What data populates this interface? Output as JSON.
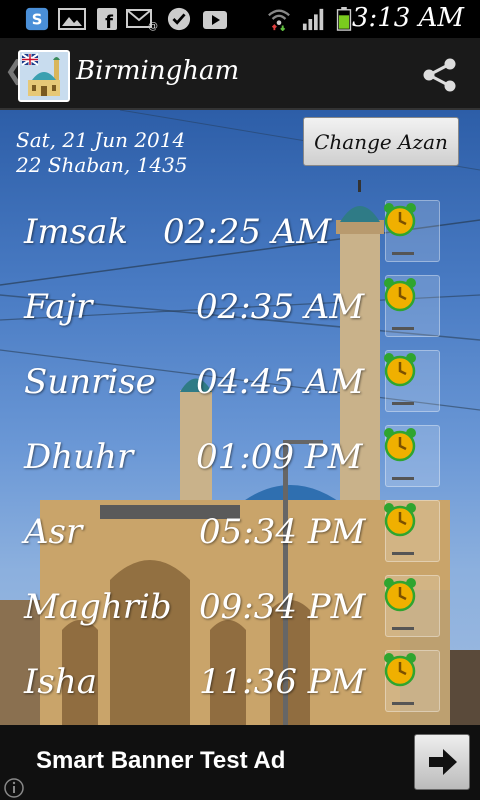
{
  "status_bar": {
    "time": "3:13 AM",
    "icons": [
      "skype-icon",
      "gallery-icon",
      "facebook-icon",
      "email-icon",
      "check-icon",
      "youtube-icon",
      "wifi-icon",
      "signal-icon",
      "battery-icon"
    ]
  },
  "action_bar": {
    "title": "Birmingham",
    "back_icon": "chevron-left-icon",
    "logo_icon": "mosque-flag-icon",
    "share_icon": "share-icon"
  },
  "main": {
    "date_gregorian": "Sat, 21 Jun 2014",
    "date_hijri": "22 Shaban, 1435",
    "change_azan_label": "Change Azan",
    "prayers": [
      {
        "name": "Imsak",
        "time": "02:25 AM"
      },
      {
        "name": "Fajr",
        "time": "02:35 AM"
      },
      {
        "name": "Sunrise",
        "time": "04:45 AM"
      },
      {
        "name": "Dhuhr",
        "time": "01:09 PM"
      },
      {
        "name": "Asr",
        "time": "05:34 PM"
      },
      {
        "name": "Maghrib",
        "time": "09:34 PM"
      },
      {
        "name": "Isha",
        "time": "11:36 PM"
      }
    ]
  },
  "ad": {
    "text": "Smart Banner Test Ad",
    "arrow_icon": "arrow-right-icon",
    "info_icon": "info-icon"
  },
  "colors": {
    "accent_alarm": "#f0b000",
    "alarm_green": "#2fa52f",
    "sky": "#4a7cc4"
  }
}
